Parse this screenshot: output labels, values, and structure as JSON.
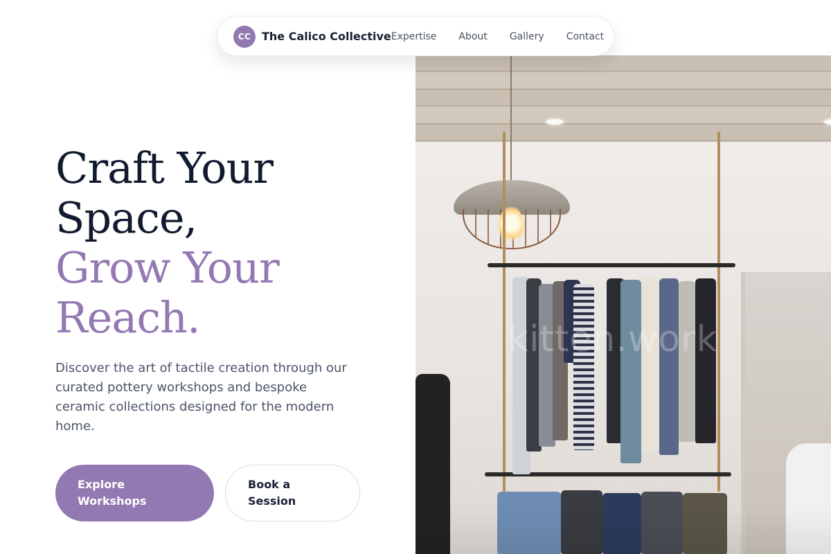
{
  "nav": {
    "logo_initials": "CC",
    "brand": "The Calico Collective",
    "links": [
      "Expertise",
      "About",
      "Gallery",
      "Contact"
    ]
  },
  "hero": {
    "headline_line1": "Craft Your",
    "headline_line2": "Space,",
    "headline_accent_line1": "Grow Your",
    "headline_accent_line2": "Reach.",
    "description": "Discover the art of tactile creation through our curated pottery workshops and bespoke ceramic collections designed for the modern home.",
    "primary_button": "Explore Workshops",
    "secondary_button": "Book a Session",
    "image_watermark": "kitten.work"
  },
  "colors": {
    "accent": "#9379b2",
    "heading": "#121a30",
    "body_text": "#4a5366"
  }
}
